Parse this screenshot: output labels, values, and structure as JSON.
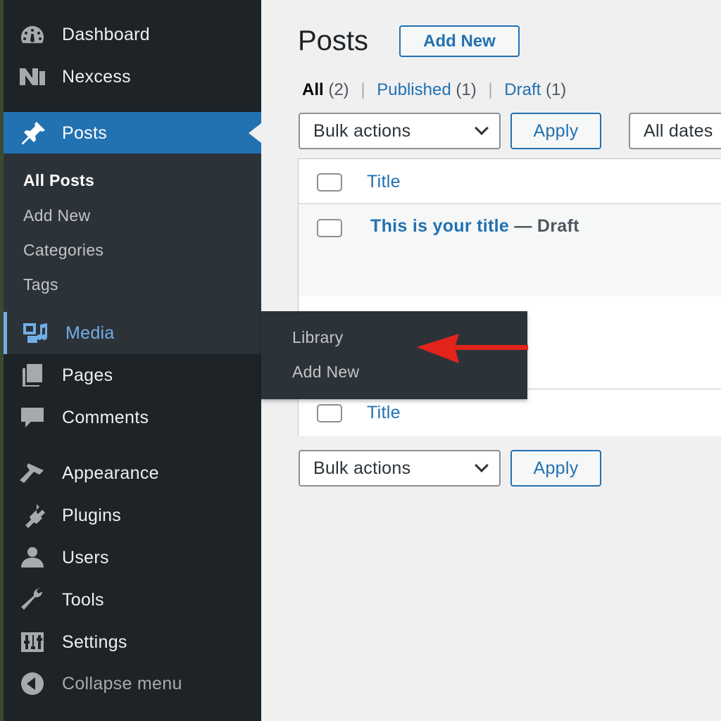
{
  "sidebar": {
    "items": [
      {
        "label": "Dashboard",
        "icon": "dashboard-icon"
      },
      {
        "label": "Nexcess",
        "icon": "nexcess-icon"
      },
      {
        "label": "Posts",
        "icon": "pin-icon"
      },
      {
        "label": "Media",
        "icon": "media-icon"
      },
      {
        "label": "Pages",
        "icon": "pages-icon"
      },
      {
        "label": "Comments",
        "icon": "comments-icon"
      },
      {
        "label": "Appearance",
        "icon": "appearance-icon"
      },
      {
        "label": "Plugins",
        "icon": "plugins-icon"
      },
      {
        "label": "Users",
        "icon": "users-icon"
      },
      {
        "label": "Tools",
        "icon": "tools-icon"
      },
      {
        "label": "Settings",
        "icon": "settings-icon"
      },
      {
        "label": "Collapse menu",
        "icon": "collapse-icon"
      }
    ],
    "posts_submenu": [
      "All Posts",
      "Add New",
      "Categories",
      "Tags"
    ]
  },
  "media_flyout": [
    "Library",
    "Add New"
  ],
  "main": {
    "title": "Posts",
    "add_new": "Add New",
    "filters": {
      "all": "All",
      "all_count": "(2)",
      "published": "Published",
      "published_count": "(1)",
      "draft": "Draft",
      "draft_count": "(1)",
      "separator": "|"
    },
    "bulk_actions": "Bulk actions",
    "apply": "Apply",
    "date_filter": "All dates",
    "table": {
      "column_title": "Title",
      "rows": [
        {
          "title": "This is your title",
          "state": " — Draft"
        }
      ]
    }
  },
  "colors": {
    "sidebar_bg": "#1d2327",
    "accent": "#2271b1",
    "hover_accent": "#72aee6",
    "annotation_arrow": "#e3241b"
  }
}
